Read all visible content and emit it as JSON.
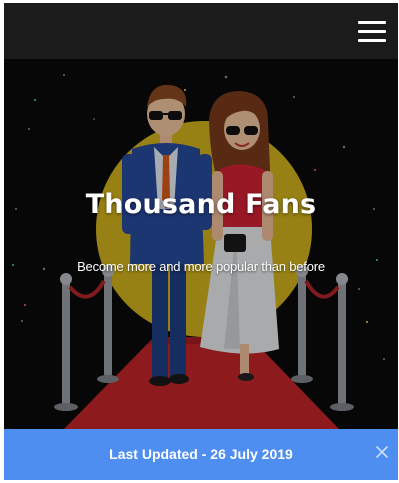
{
  "header": {
    "menu_icon": "hamburger-menu-icon"
  },
  "hero": {
    "title": "Thousand Fans",
    "subtitle": "Become more and more popular than before",
    "illustration": "celebrity-couple-red-carpet"
  },
  "notice": {
    "text": "Last Updated - 26 July 2019",
    "close_icon": "close-icon",
    "background_color": "#4d8ef0"
  },
  "colors": {
    "topbar": "#1b1b1b",
    "hero_background": "#0a0a0a",
    "spotlight": "#e3c21f",
    "carpet": "#c4262a"
  }
}
